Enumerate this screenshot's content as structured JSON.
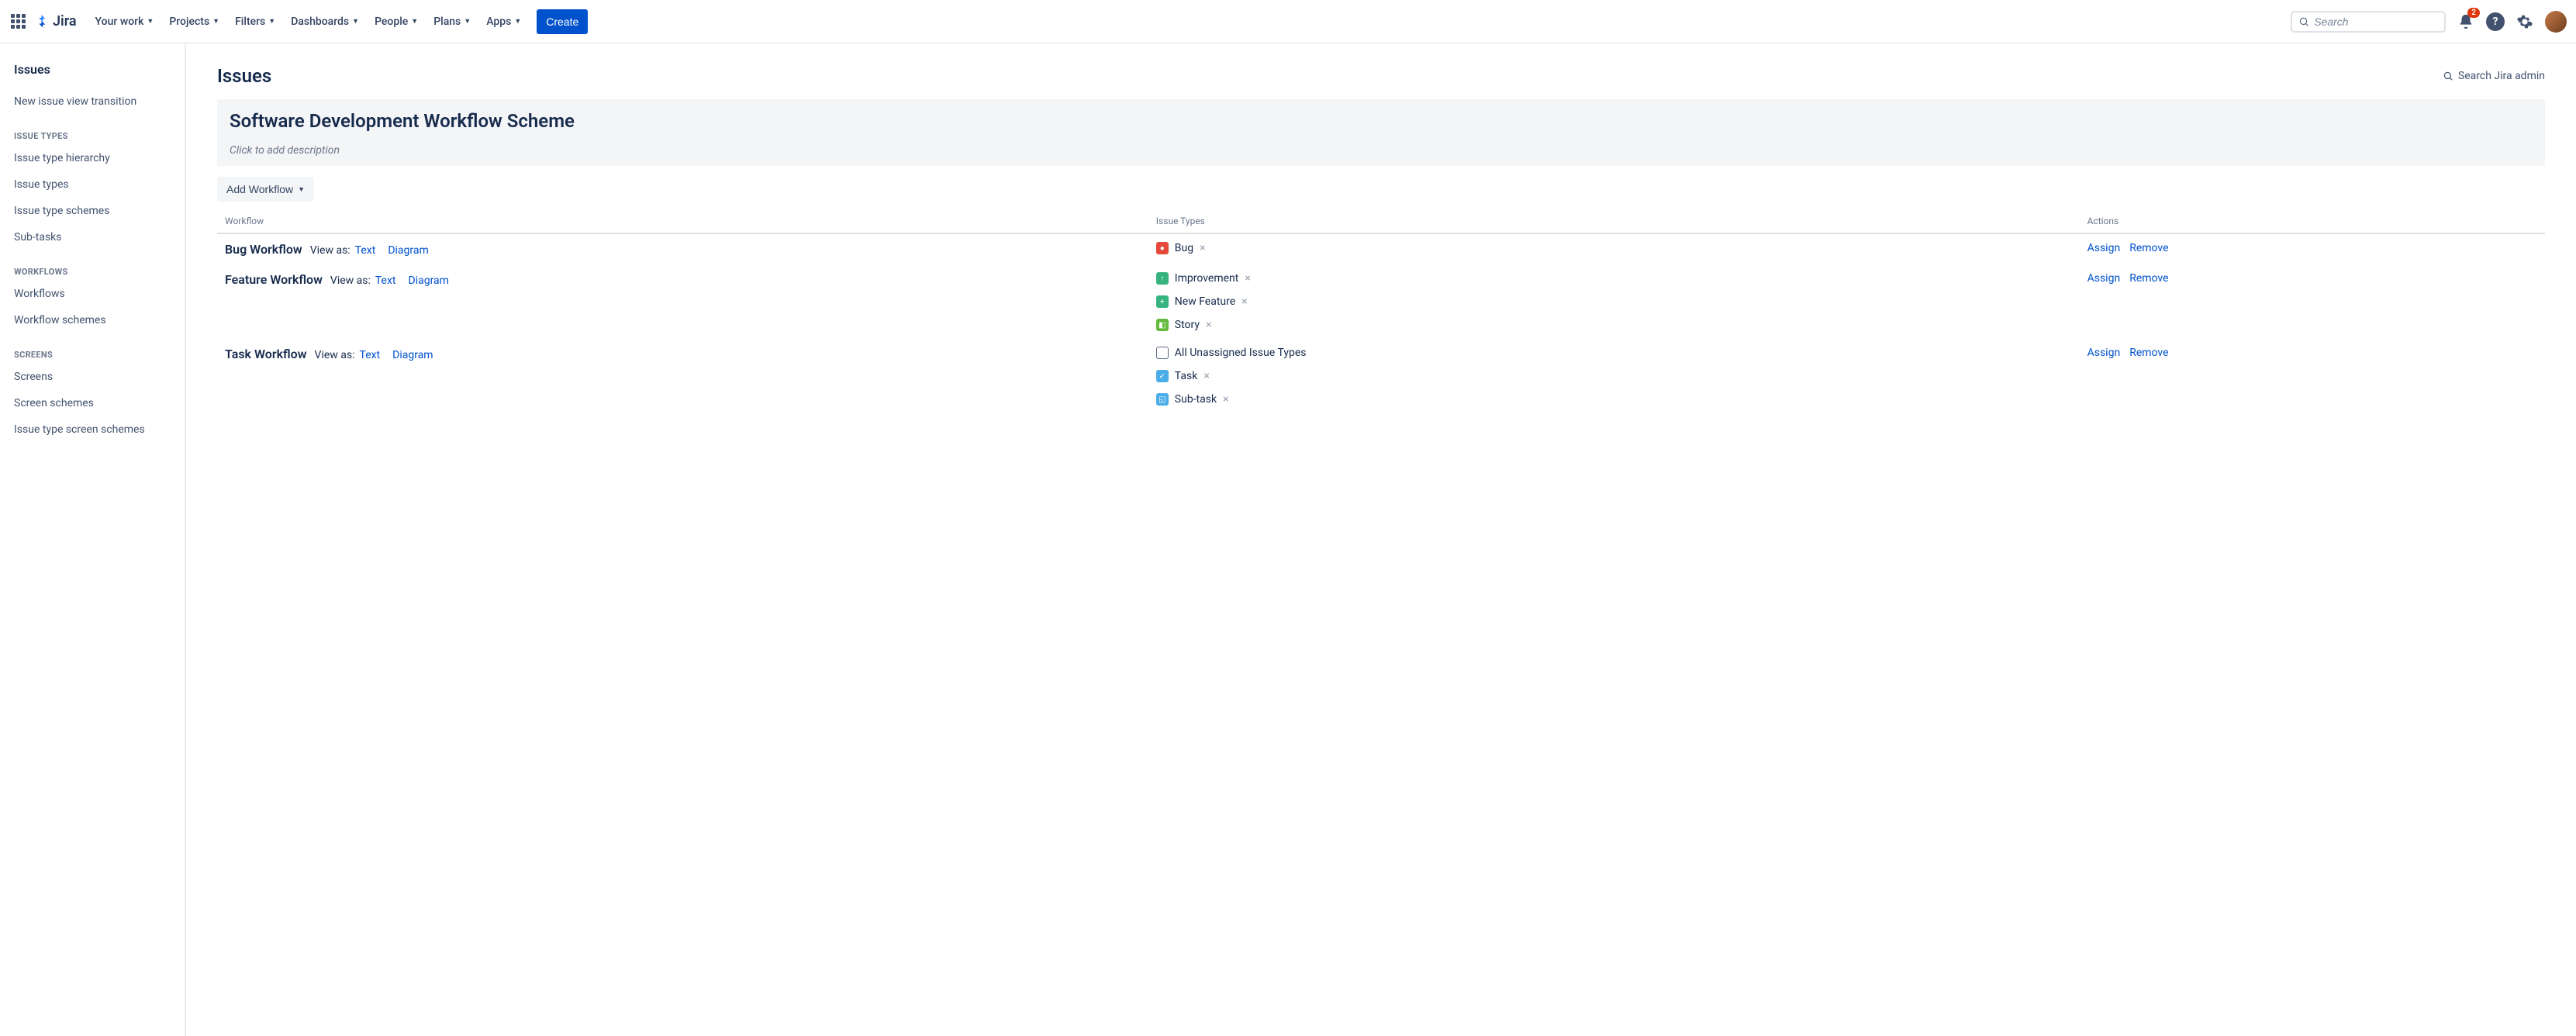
{
  "nav": {
    "product": "Jira",
    "items": [
      "Your work",
      "Projects",
      "Filters",
      "Dashboards",
      "People",
      "Plans",
      "Apps"
    ],
    "create": "Create",
    "search_placeholder": "Search",
    "notification_count": "2"
  },
  "sidebar": {
    "title": "Issues",
    "top_item": "New issue view transition",
    "groups": [
      {
        "label": "ISSUE TYPES",
        "items": [
          "Issue type hierarchy",
          "Issue types",
          "Issue type schemes",
          "Sub-tasks"
        ]
      },
      {
        "label": "WORKFLOWS",
        "items": [
          "Workflows",
          "Workflow schemes"
        ]
      },
      {
        "label": "SCREENS",
        "items": [
          "Screens",
          "Screen schemes",
          "Issue type screen schemes"
        ]
      }
    ]
  },
  "page": {
    "title": "Issues",
    "admin_search": "Search Jira admin",
    "scheme_name": "Software Development Workflow Scheme",
    "desc_placeholder": "Click to add description",
    "add_workflow": "Add Workflow",
    "view_as_label": "View as:",
    "view_text": "Text",
    "view_diagram": "Diagram",
    "assign": "Assign",
    "remove": "Remove",
    "columns": {
      "workflow": "Workflow",
      "issue_types": "Issue Types",
      "actions": "Actions"
    },
    "rows": [
      {
        "name": "Bug Workflow",
        "types": [
          {
            "icon": "bug",
            "label": "Bug"
          }
        ]
      },
      {
        "name": "Feature Workflow",
        "types": [
          {
            "icon": "improve",
            "label": "Improvement"
          },
          {
            "icon": "feature",
            "label": "New Feature"
          },
          {
            "icon": "story",
            "label": "Story"
          }
        ]
      },
      {
        "name": "Task Workflow",
        "types": [
          {
            "icon": "unassigned",
            "label": "All Unassigned Issue Types",
            "no_remove": true
          },
          {
            "icon": "task",
            "label": "Task"
          },
          {
            "icon": "subtask",
            "label": "Sub-task"
          }
        ]
      }
    ]
  }
}
